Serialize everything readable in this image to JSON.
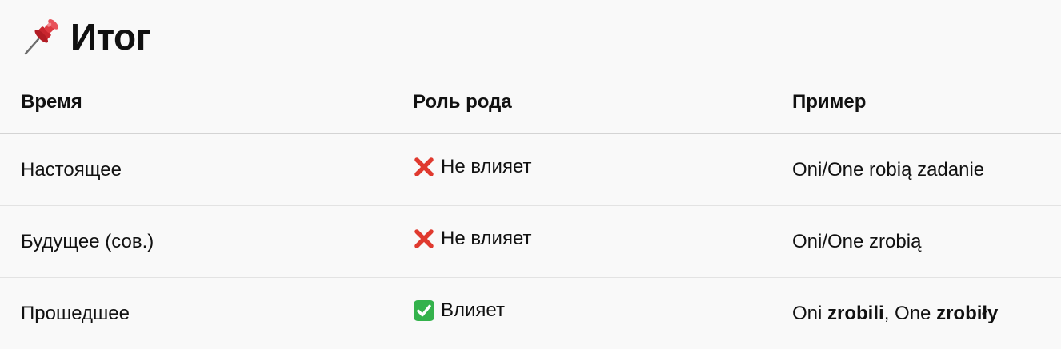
{
  "heading": {
    "icon": "pushpin-icon",
    "title": "Итог"
  },
  "table": {
    "headers": [
      "Время",
      "Роль рода",
      "Пример"
    ],
    "rows": [
      {
        "tense": "Настоящее",
        "role": {
          "icon": "cross-mark-icon",
          "text": "Не влияет"
        },
        "example": {
          "plain": "Oni/One robią zadanie"
        }
      },
      {
        "tense": "Будущее (сов.)",
        "role": {
          "icon": "cross-mark-icon",
          "text": "Не влияет"
        },
        "example": {
          "plain": "Oni/One zrobią"
        }
      },
      {
        "tense": "Прошедшее",
        "role": {
          "icon": "check-mark-icon",
          "text": "Влияет"
        },
        "example": {
          "part1": "Oni ",
          "part1_bold": "zrobili",
          "part2": ", One ",
          "part2_bold": "zrobiły"
        }
      }
    ]
  },
  "colors": {
    "background": "#f9f9f9",
    "text": "#111111",
    "cross": "#e03a2f",
    "check": "#34b24c",
    "pin": "#d8343a"
  }
}
